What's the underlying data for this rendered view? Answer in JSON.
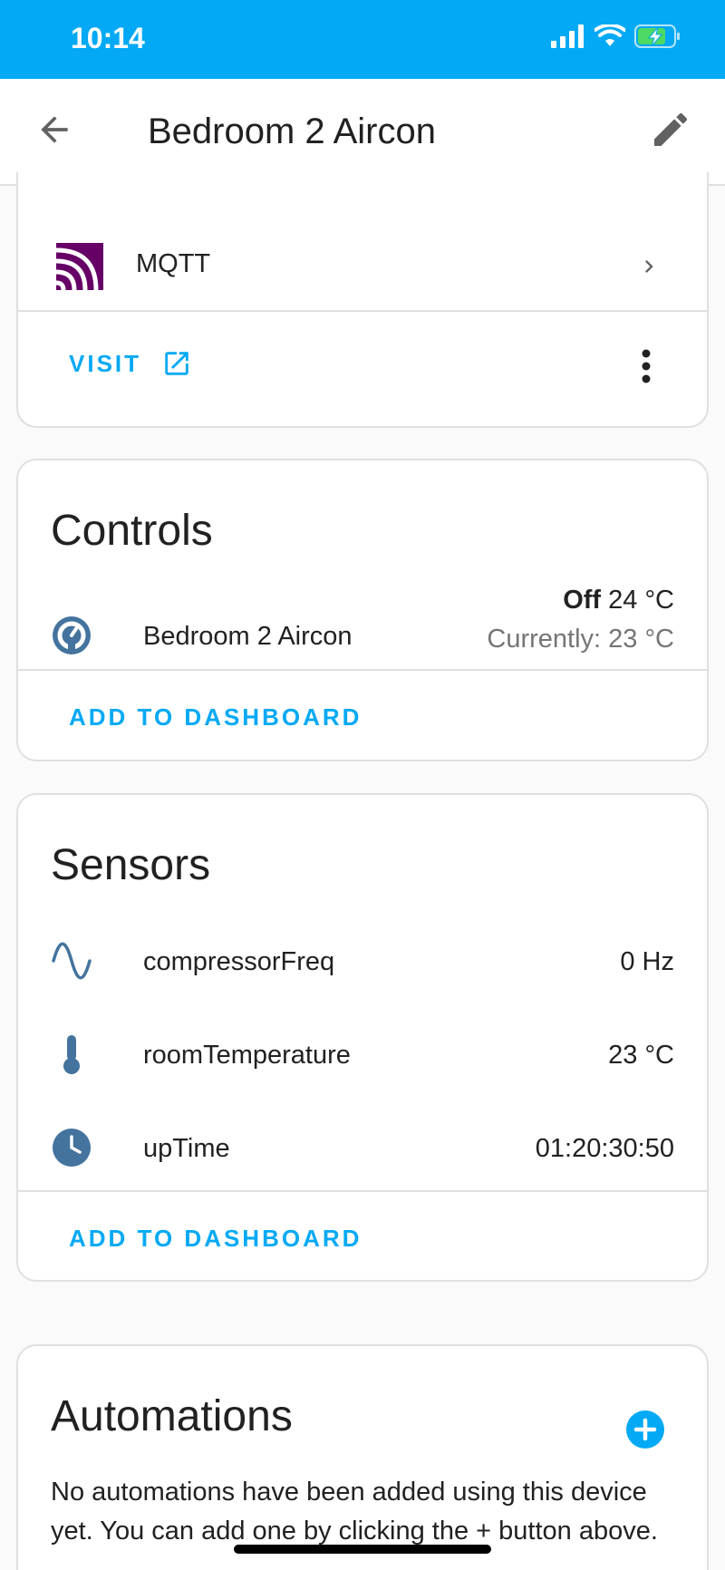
{
  "status_bar": {
    "time": "10:14"
  },
  "header": {
    "title": "Bedroom 2 Aircon"
  },
  "integration": {
    "name": "MQTT",
    "visit_label": "VISIT"
  },
  "controls": {
    "title": "Controls",
    "entity_name": "Bedroom 2 Aircon",
    "state": "Off",
    "target_temp": "24 °C",
    "current_temp": "Currently: 23 °C",
    "add_label": "ADD TO DASHBOARD"
  },
  "sensors": {
    "title": "Sensors",
    "items": [
      {
        "name": "compressorFreq",
        "value": "0 Hz",
        "icon": "sine-wave-icon"
      },
      {
        "name": "roomTemperature",
        "value": "23 °C",
        "icon": "thermometer-icon"
      },
      {
        "name": "upTime",
        "value": "01:20:30:50",
        "icon": "clock-icon"
      }
    ],
    "add_label": "ADD TO DASHBOARD"
  },
  "automations": {
    "title": "Automations",
    "empty_text": "No automations have been added using this device yet. You can add one by clicking the + button above."
  },
  "colors": {
    "accent": "#03a9f4",
    "icon": "#44739e",
    "mqtt": "#660066"
  }
}
